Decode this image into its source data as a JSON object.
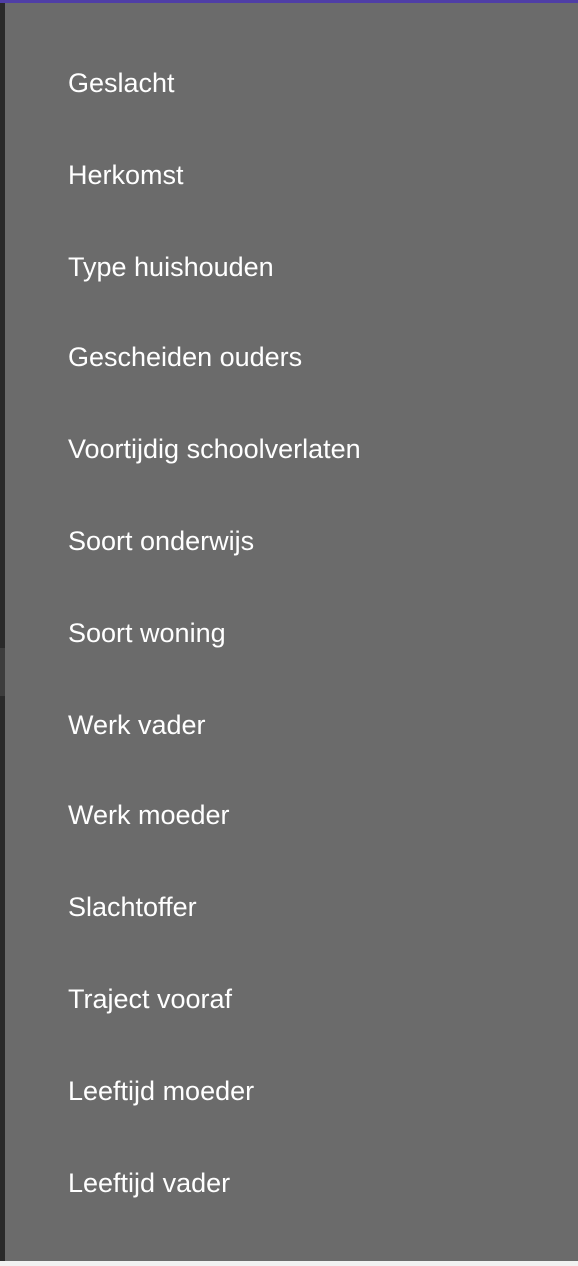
{
  "menu": {
    "items": [
      {
        "label": "Geslacht"
      },
      {
        "label": "Herkomst"
      },
      {
        "label": "Type huishouden"
      },
      {
        "label": "Gescheiden ouders"
      },
      {
        "label": "Voortijdig schoolverlaten"
      },
      {
        "label": "Soort onderwijs"
      },
      {
        "label": "Soort woning"
      },
      {
        "label": "Werk vader"
      },
      {
        "label": "Werk moeder"
      },
      {
        "label": "Slachtoffer"
      },
      {
        "label": "Traject vooraf"
      },
      {
        "label": "Leeftijd moeder"
      },
      {
        "label": "Leeftijd vader"
      }
    ]
  },
  "colors": {
    "panel_background": "#6b6b6b",
    "accent_top_bar": "#4f3ea6",
    "text": "#ffffff"
  }
}
